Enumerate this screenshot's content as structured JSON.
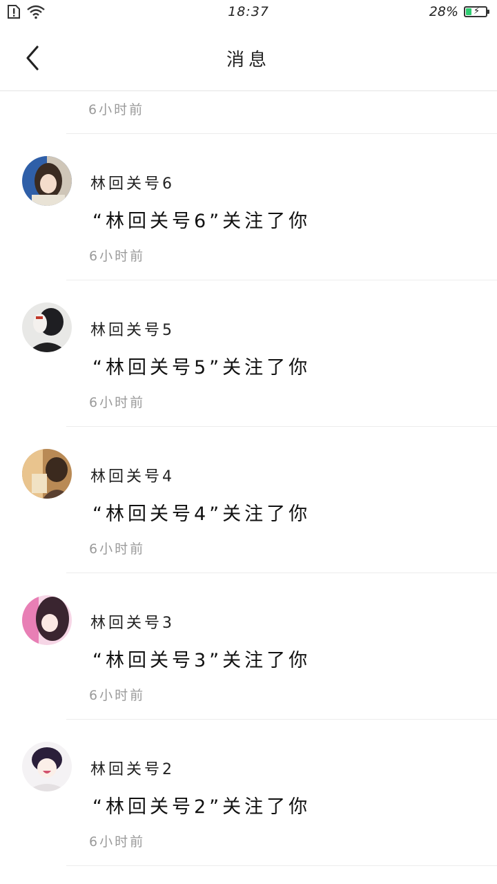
{
  "status_bar": {
    "time": "18:37",
    "battery_percent": "28%",
    "battery_level": 0.28
  },
  "header": {
    "title": "消息"
  },
  "partial_item": {
    "time": "6小时前"
  },
  "notifications": [
    {
      "name": "林回关号6",
      "message": "“林回关号6”关注了你",
      "time": "6小时前"
    },
    {
      "name": "林回关号5",
      "message": "“林回关号5”关注了你",
      "time": "6小时前"
    },
    {
      "name": "林回关号4",
      "message": "“林回关号4”关注了你",
      "time": "6小时前"
    },
    {
      "name": "林回关号3",
      "message": "“林回关号3”关注了你",
      "time": "6小时前"
    },
    {
      "name": "林回关号2",
      "message": "“林回关号2”关注了你",
      "time": "6小时前"
    }
  ],
  "icons": {
    "back": "chevron-left-icon",
    "wifi": "wifi-icon",
    "sim": "sim-alert-icon",
    "battery": "battery-charging-icon"
  }
}
